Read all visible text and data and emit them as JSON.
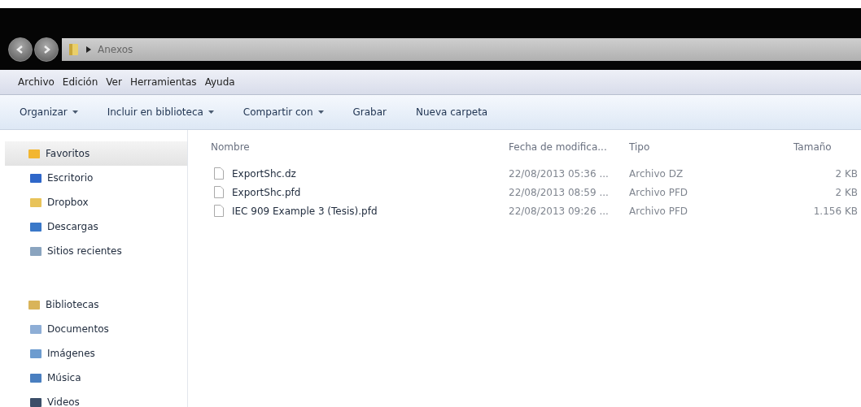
{
  "address_bar": {
    "path": "Anexos"
  },
  "menu_bar": [
    "Archivo",
    "Edición",
    "Ver",
    "Herramientas",
    "Ayuda"
  ],
  "toolbar": [
    {
      "label": "Organizar",
      "dropdown": true
    },
    {
      "label": "Incluir en biblioteca",
      "dropdown": true
    },
    {
      "label": "Compartir con",
      "dropdown": true
    },
    {
      "label": "Grabar",
      "dropdown": false
    },
    {
      "label": "Nueva carpeta",
      "dropdown": false
    }
  ],
  "sidebar": {
    "groups": [
      {
        "label": "Favoritos",
        "kind": "star",
        "selected": true,
        "items": [
          {
            "label": "Escritorio",
            "kind": "desktop"
          },
          {
            "label": "Dropbox",
            "kind": "folder"
          },
          {
            "label": "Descargas",
            "kind": "download"
          },
          {
            "label": "Sitios recientes",
            "kind": "recent"
          }
        ]
      },
      {
        "label": "Bibliotecas",
        "kind": "library",
        "selected": false,
        "items": [
          {
            "label": "Documentos",
            "kind": "document"
          },
          {
            "label": "Imágenes",
            "kind": "image"
          },
          {
            "label": "Música",
            "kind": "music"
          },
          {
            "label": "Videos",
            "kind": "video"
          }
        ]
      }
    ]
  },
  "table": {
    "columns": [
      "Nombre",
      "Fecha de modifica...",
      "Tipo",
      "Tamaño"
    ],
    "rows": [
      {
        "name": "ExportShc.dz",
        "date": "22/08/2013 05:36 ...",
        "type": "Archivo DZ",
        "size": "2 KB"
      },
      {
        "name": "ExportShc.pfd",
        "date": "22/08/2013 08:59 ...",
        "type": "Archivo PFD",
        "size": "2 KB"
      },
      {
        "name": "IEC 909 Example 3 (Tesis).pfd",
        "date": "22/08/2013 09:26 ...",
        "type": "Archivo PFD",
        "size": "1.156 KB"
      }
    ]
  }
}
